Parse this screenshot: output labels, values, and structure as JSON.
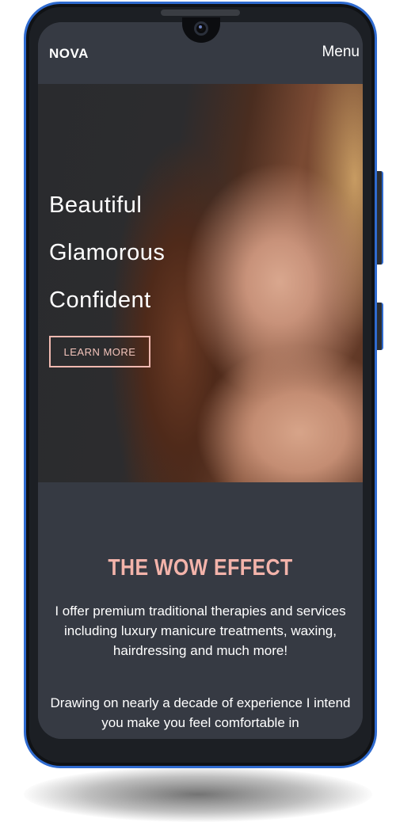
{
  "navbar": {
    "brand": "NOVA",
    "menu_label": "Menu"
  },
  "hero": {
    "lines": [
      "Beautiful",
      "Glamorous",
      "Confident"
    ],
    "cta_label": "LEARN MORE"
  },
  "section": {
    "title": "THE WOW EFFECT",
    "paragraph1": "I offer premium traditional therapies and services including luxury manicure treatments, waxing, hairdressing and much more!",
    "paragraph2": "Drawing on nearly a decade of experience I intend you make you feel comfortable in"
  },
  "colors": {
    "frame_accent": "#2f6bd0",
    "screen_bg": "#363a43",
    "title_pink": "#f3b3aa",
    "cta_pink": "#f0b9b0"
  }
}
